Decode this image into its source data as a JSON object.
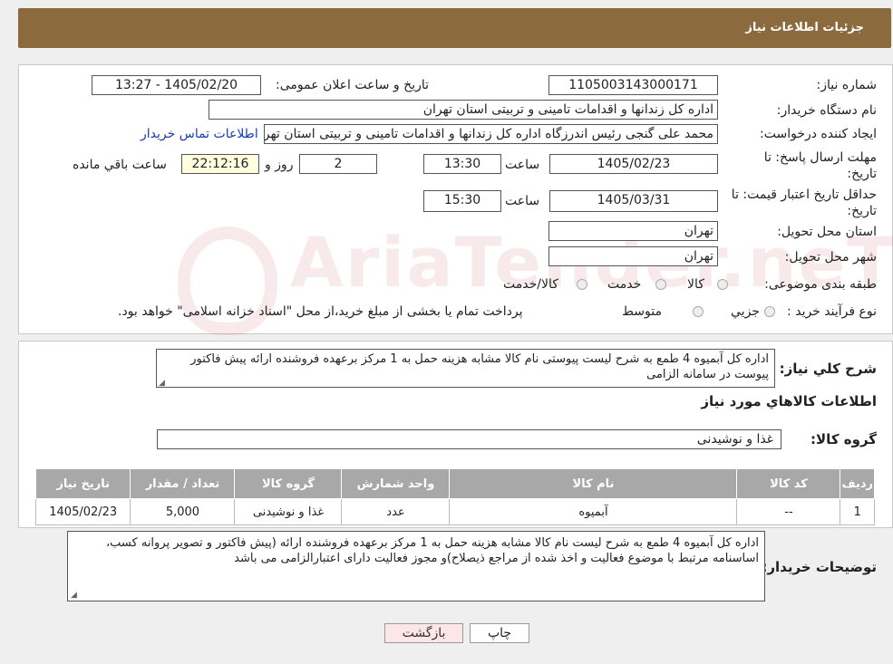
{
  "header": {
    "title": "جزئیات اطلاعات نیاز"
  },
  "watermark": {
    "text": "AriaTender.neT"
  },
  "form": {
    "need_number_label": "شماره نیاز:",
    "need_number": "1105003143000171",
    "announce_label": "تاریخ و ساعت اعلان عمومی:",
    "announce_value": "1405/02/20 - 13:27",
    "buyer_label": "نام دستگاه خریدار:",
    "buyer_value": "اداره کل زندانها و اقدامات تامینی و تربیتی استان تهران",
    "creator_label": "ایجاد کننده درخواست:",
    "creator_value": "محمد علی گنجی رئیس اندرزگاه  اداره کل زندانها و اقدامات تامینی و تربیتی استان تهران",
    "contact_link": "اطلاعات تماس خریدار",
    "deadline_label": "مهلت ارسال پاسخ: تا تاریخ:",
    "deadline_date": "1405/02/23",
    "time_label": "ساعت",
    "deadline_time": "13:30",
    "days_value": "2",
    "days_label": "روز و",
    "remaining_time": "22:12:16",
    "remaining_label": "ساعت باقي مانده",
    "validity_label": "حداقل تاریخ اعتبار قیمت: تا تاریخ:",
    "validity_date": "1405/03/31",
    "validity_time": "15:30",
    "province_label": "استان محل تحویل:",
    "province_value": "تهران",
    "city_label": "شهر محل تحویل:",
    "city_value": "تهران",
    "category_label": "طبقه بندی موضوعی:",
    "category_options": [
      "کالا",
      "خدمت",
      "کالا/خدمت"
    ],
    "process_label": "نوع فرآیند خرید :",
    "process_options": [
      "جزيي",
      "متوسط"
    ],
    "process_note": "پرداخت تمام یا بخشی از مبلغ خرید،از محل \"اسناد خزانه اسلامی\" خواهد بود."
  },
  "summary": {
    "label": "شرح کلي نياز:",
    "text": "اداره کل آبمیوه 4 طمع به شرح لیست پیوستی نام کالا مشابه هزینه حمل به 1 مرکز برعهده فروشنده ارائه پیش فاکتور  پیوست در سامانه الزامی"
  },
  "goods": {
    "section_title": "اطلاعات کالاهاي مورد نياز",
    "group_label": "گروه کالا:",
    "group_value": "غذا و نوشیدنی",
    "columns": [
      "رديف",
      "کد کالا",
      "نام کالا",
      "واحد شمارش",
      "گروه کالا",
      "تعداد / مقدار",
      "تاريخ نياز"
    ],
    "rows": [
      [
        "1",
        "--",
        "آبمیوه",
        "عدد",
        "غذا و نوشیدنی",
        "5,000",
        "1405/02/23"
      ]
    ]
  },
  "buyer_notes": {
    "label": "توضیحات خریدار:",
    "text": "اداره کل آبمیوه 4 طمع به شرح لیست نام کالا مشابه هزینه حمل  به 1 مرکز برعهده فروشنده ارائه (پیش فاکتور و  تصویر پروانه کسب، اساسنامه مرتبط با موضوع فعالیت و اخذ شده از مراجع ذیصلاح)و مجوز فعالیت دارای اعتبارالزامی می باشد"
  },
  "buttons": {
    "print": "چاپ",
    "back": "بازگشت"
  }
}
